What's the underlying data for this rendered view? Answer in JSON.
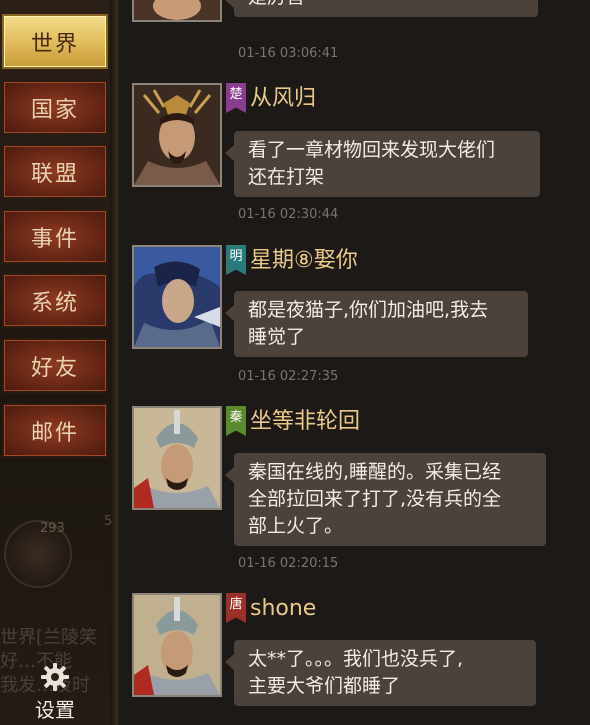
{
  "sidebar": {
    "tabs": [
      {
        "label": "世界",
        "active": true
      },
      {
        "label": "国家",
        "active": false
      },
      {
        "label": "联盟",
        "active": false
      },
      {
        "label": "事件",
        "active": false
      },
      {
        "label": "系统",
        "active": false
      },
      {
        "label": "好友",
        "active": false
      },
      {
        "label": "邮件",
        "active": false
      }
    ],
    "settings_label": "设置",
    "background_num": "293",
    "background_num2": "5",
    "background_lines": [
      "世界[兰陵笑",
      "好…不能",
      "我发…及时"
    ]
  },
  "colors": {
    "active_tab": "#e2bd5c",
    "tab": "#6a2816",
    "name": "#e9c98a",
    "bubble": "#4b423c",
    "badge_chu": "#8a3c8e",
    "badge_ming": "#2a7a7a",
    "badge_qin": "#5a8a2a",
    "badge_tang": "#9a3028"
  },
  "messages": [
    {
      "name": "",
      "badge": "",
      "text": [
        "是厉害"
      ],
      "time": "01-16 03:06:41",
      "icon": "warlord-avatar"
    },
    {
      "name": "从风归",
      "badge": "楚",
      "badge_color": "#8a3c8e",
      "text": [
        "看了一章材物回来发现大佬们",
        "还在打架"
      ],
      "time": "01-16 02:30:44",
      "icon": "warlord-avatar"
    },
    {
      "name": "星期⑧娶你",
      "badge": "明",
      "badge_color": "#2a7a7a",
      "text": [
        "都是夜猫子,你们加油吧,我去",
        "睡觉了"
      ],
      "time": "01-16 02:27:35",
      "icon": "warrior-avatar"
    },
    {
      "name": "坐等非轮回",
      "badge": "秦",
      "badge_color": "#5a8a2a",
      "text": [
        "秦国在线的,睡醒的。采集已经",
        "全部拉回来了打了,没有兵的全",
        "部上火了。"
      ],
      "time": "01-16 02:20:15",
      "icon": "general-avatar"
    },
    {
      "name": "shone",
      "badge": "唐",
      "badge_color": "#9a3028",
      "text": [
        "太**了。。。我们也没兵了,",
        "主要大爷们都睡了"
      ],
      "time": "",
      "icon": "general-avatar"
    }
  ]
}
